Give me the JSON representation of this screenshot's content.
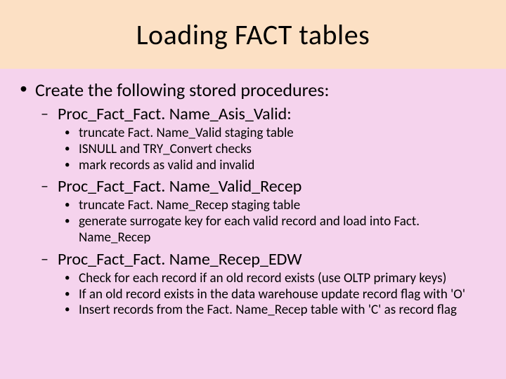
{
  "title": "Loading FACT tables",
  "bullet": {
    "main": "Create the following stored procedures:",
    "procs": [
      {
        "name": "Proc_Fact_Fact. Name_Asis_Valid:",
        "items": [
          "truncate Fact. Name_Valid staging table",
          "ISNULL and TRY_Convert checks",
          "mark records as valid and invalid"
        ]
      },
      {
        "name": "Proc_Fact_Fact. Name_Valid_Recep",
        "items": [
          "truncate Fact. Name_Recep staging table",
          "generate surrogate key for each valid record and load into Fact. Name_Recep"
        ]
      },
      {
        "name": "Proc_Fact_Fact. Name_Recep_EDW",
        "items": [
          "Check for each record if an old record exists (use OLTP primary keys)",
          "If an old record exists in the data warehouse update record flag with 'O'",
          "Insert records from the Fact. Name_Recep table with 'C' as record flag"
        ]
      }
    ]
  }
}
